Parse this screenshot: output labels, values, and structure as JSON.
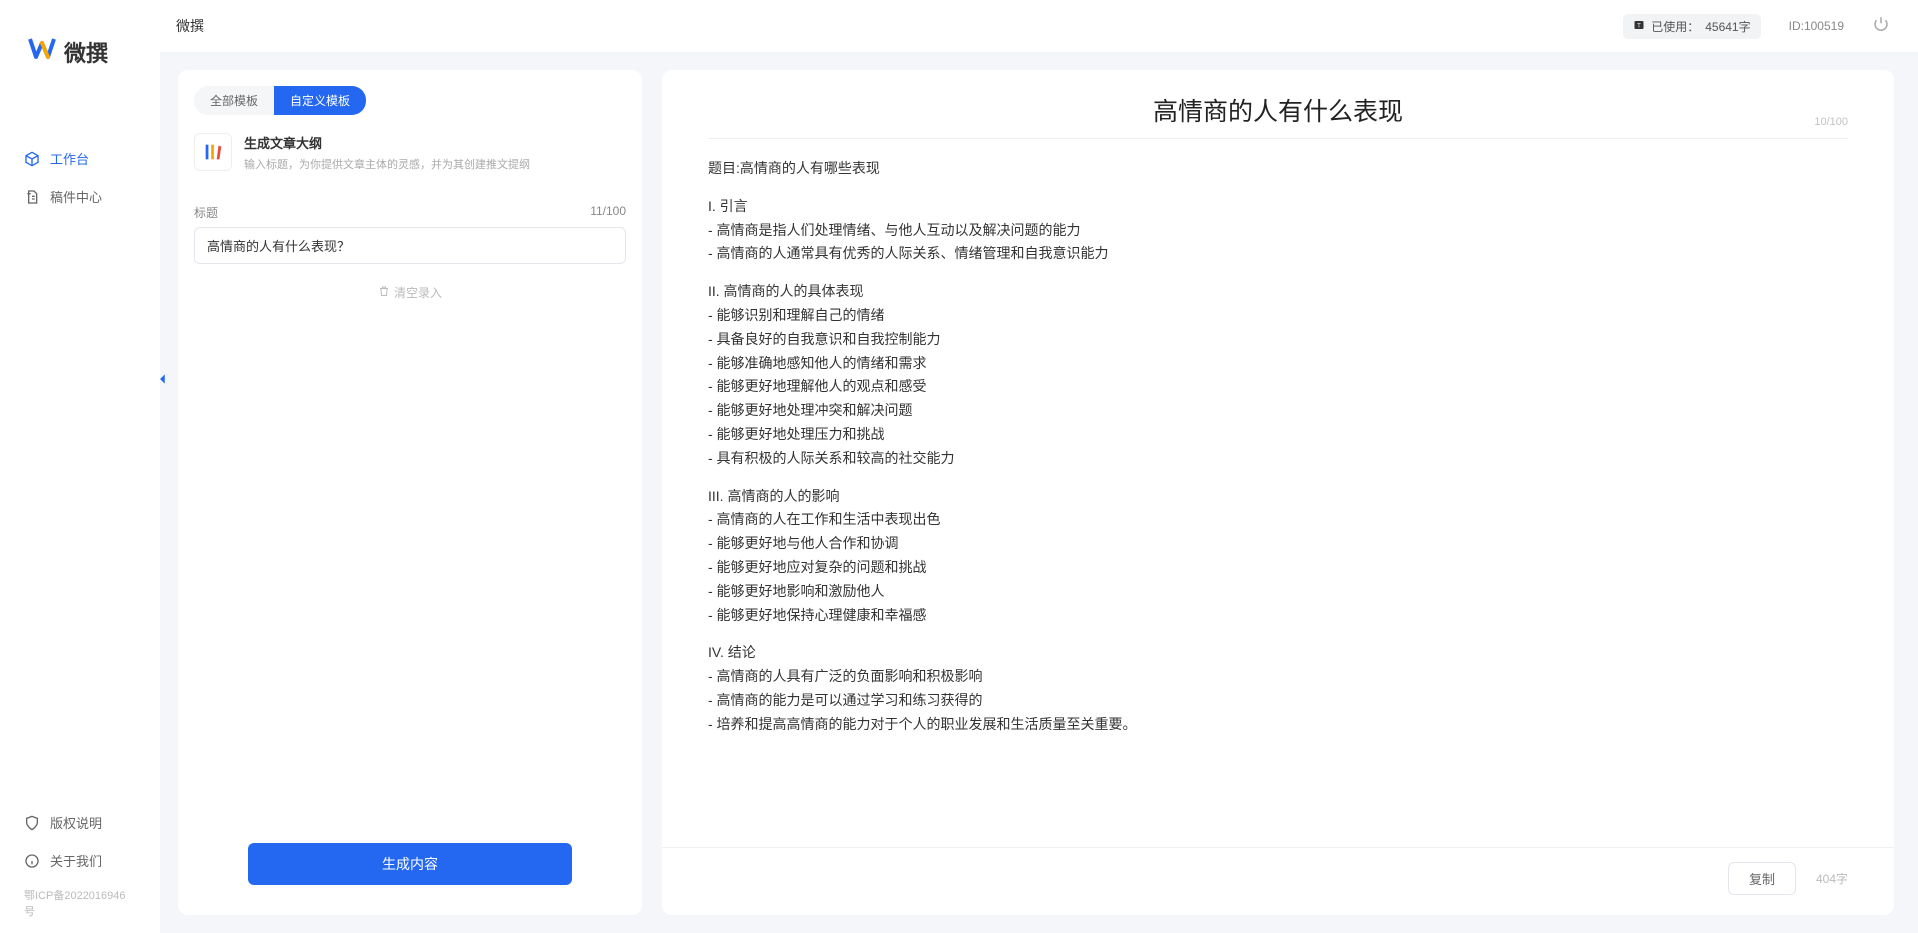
{
  "app": {
    "name": "微撰",
    "logo_text": "微撰"
  },
  "sidebar": {
    "items": [
      {
        "label": "工作台",
        "icon": "cube-icon",
        "active": true
      },
      {
        "label": "稿件中心",
        "icon": "doc-icon",
        "active": false
      }
    ],
    "bottom": [
      {
        "label": "版权说明",
        "icon": "shield-icon"
      },
      {
        "label": "关于我们",
        "icon": "info-icon"
      }
    ],
    "icp": "鄂ICP备2022016946号"
  },
  "topbar": {
    "usage_prefix": "已使用：",
    "usage_value": "45641字",
    "user_id_label": "ID:100519"
  },
  "tabs": {
    "all": "全部模板",
    "custom": "自定义模板"
  },
  "template": {
    "title": "生成文章大纲",
    "desc": "输入标题，为你提供文章主体的灵感，并为其创建推文提纲"
  },
  "form": {
    "label": "标题",
    "counter": "11/100",
    "value": "高情商的人有什么表现？",
    "clear": "清空录入",
    "generate": "生成内容"
  },
  "output": {
    "title": "高情商的人有什么表现",
    "title_counter": "10/100",
    "body_sections": [
      "题目:高情商的人有哪些表现",
      "I. 引言\n- 高情商是指人们处理情绪、与他人互动以及解决问题的能力\n- 高情商的人通常具有优秀的人际关系、情绪管理和自我意识能力",
      "II. 高情商的人的具体表现\n- 能够识别和理解自己的情绪\n- 具备良好的自我意识和自我控制能力\n- 能够准确地感知他人的情绪和需求\n- 能够更好地理解他人的观点和感受\n- 能够更好地处理冲突和解决问题\n- 能够更好地处理压力和挑战\n- 具有积极的人际关系和较高的社交能力",
      "III. 高情商的人的影响\n- 高情商的人在工作和生活中表现出色\n- 能够更好地与他人合作和协调\n- 能够更好地应对复杂的问题和挑战\n- 能够更好地影响和激励他人\n- 能够更好地保持心理健康和幸福感",
      "IV. 结论\n- 高情商的人具有广泛的负面影响和积极影响\n- 高情商的能力是可以通过学习和练习获得的\n- 培养和提高高情商的能力对于个人的职业发展和生活质量至关重要。"
    ],
    "copy": "复制",
    "char_count": "404字"
  }
}
